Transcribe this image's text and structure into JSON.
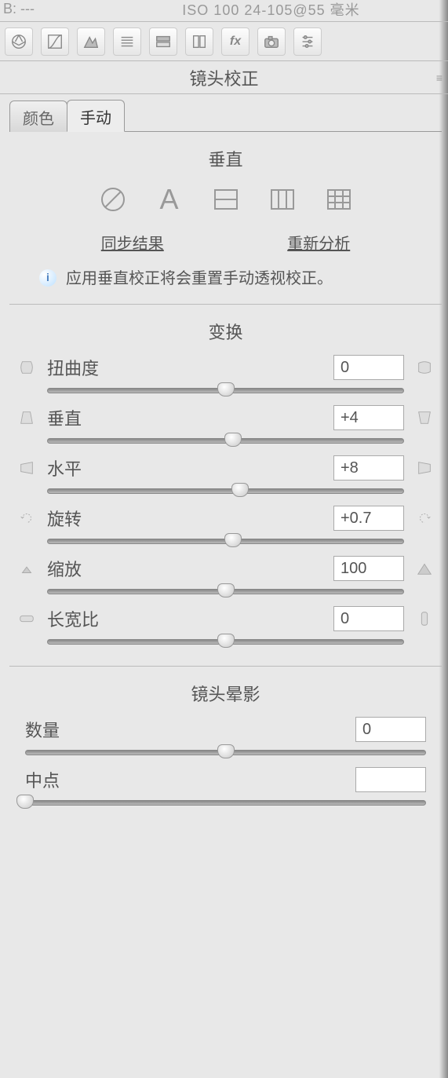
{
  "info_bar": {
    "b_label": "B:",
    "b_value": "---",
    "iso_text": "ISO 100   24-105@55 毫米"
  },
  "panel_title": "镜头校正",
  "tabs": [
    "颜色",
    "手动"
  ],
  "upright": {
    "title": "垂直",
    "links": {
      "sync": "同步结果",
      "reanalyze": "重新分析"
    },
    "info_text": "应用垂直校正将会重置手动透视校正。"
  },
  "transform": {
    "title": "变换",
    "sliders": [
      {
        "label": "扭曲度",
        "value": "0",
        "pos": 50
      },
      {
        "label": "垂直",
        "value": "+4",
        "pos": 52
      },
      {
        "label": "水平",
        "value": "+8",
        "pos": 54
      },
      {
        "label": "旋转",
        "value": "+0.7",
        "pos": 52
      },
      {
        "label": "缩放",
        "value": "100",
        "pos": 50
      },
      {
        "label": "长宽比",
        "value": "0",
        "pos": 50
      }
    ]
  },
  "vignette": {
    "title": "镜头晕影",
    "sliders": [
      {
        "label": "数量",
        "value": "0",
        "pos": 50
      },
      {
        "label": "中点",
        "value": "",
        "pos": 0
      }
    ]
  }
}
